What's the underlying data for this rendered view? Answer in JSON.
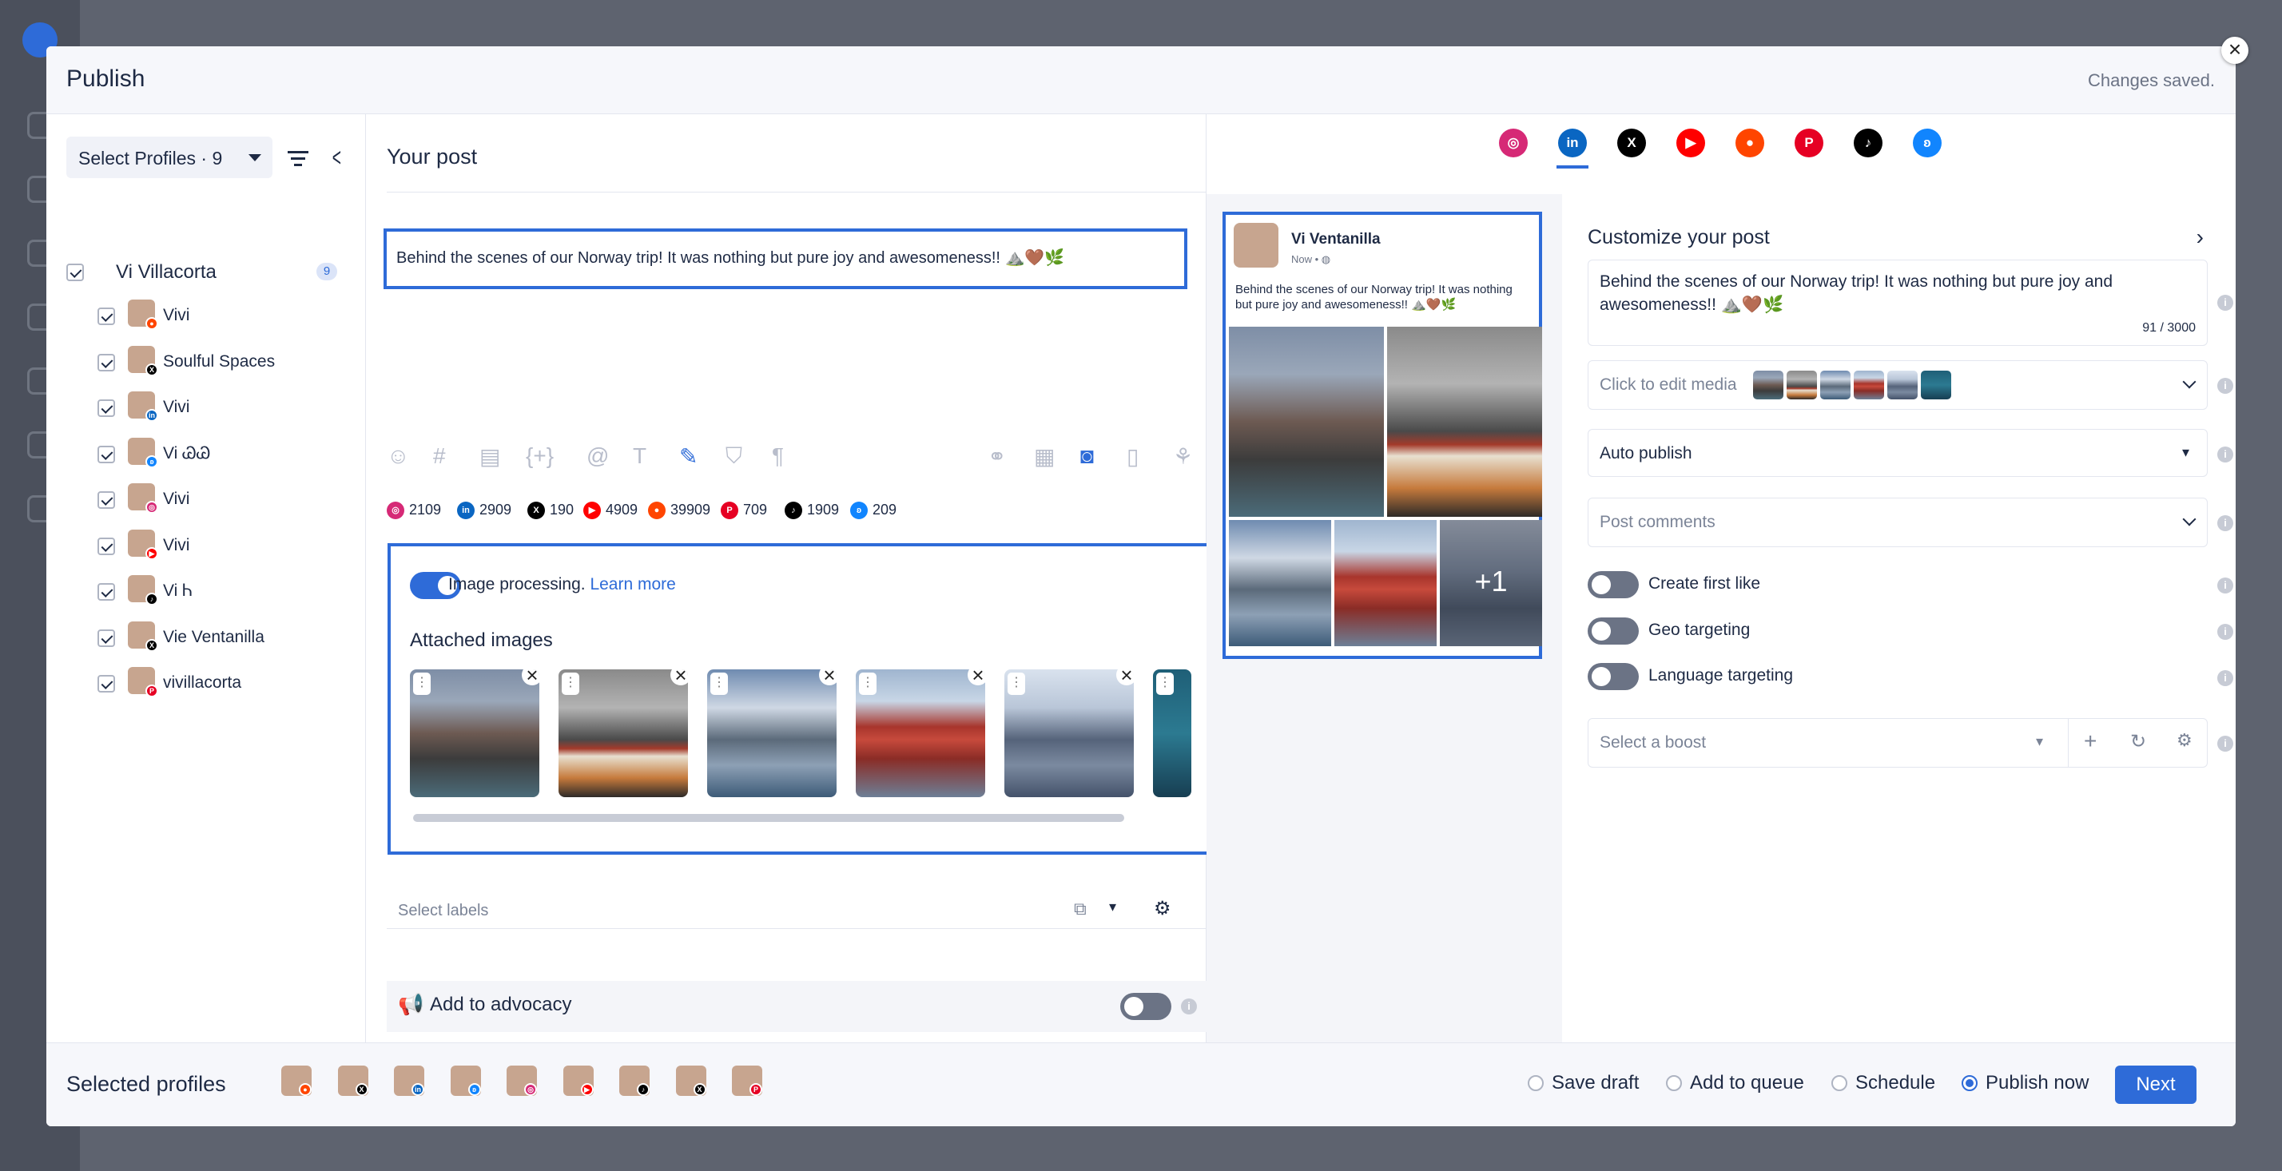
{
  "modal": {
    "title": "Publish",
    "status": "Changes saved."
  },
  "left": {
    "select_label": "Select Profiles · 9",
    "group": {
      "name": "Vi Villacorta",
      "count": "9"
    },
    "profiles": [
      {
        "name": "Vivi",
        "network": "reddit",
        "color": "#ff4500"
      },
      {
        "name": "Soulful Spaces",
        "network": "x",
        "color": "#000000"
      },
      {
        "name": "Vivi",
        "network": "linkedin",
        "color": "#0a66c2"
      },
      {
        "name": "Vi ᏊᏊ",
        "network": "bluesky",
        "color": "#1185fe"
      },
      {
        "name": "Vivi",
        "network": "instagram",
        "color": "#d62976"
      },
      {
        "name": "Vivi",
        "network": "youtube",
        "color": "#ff0000"
      },
      {
        "name": "Vi Ꮒ",
        "network": "tiktok",
        "color": "#000000"
      },
      {
        "name": "Vie Ventanilla",
        "network": "x",
        "color": "#000000"
      },
      {
        "name": "vivillacorta",
        "network": "pinterest",
        "color": "#e60023"
      }
    ]
  },
  "post": {
    "title": "Your post",
    "text": "Behind the scenes of our Norway trip! It was nothing but pure joy and awesomeness!! ⛰️🤎🌿",
    "counts": [
      {
        "net": "instagram",
        "value": "2109",
        "color": "#d62976"
      },
      {
        "net": "linkedin",
        "value": "2909",
        "color": "#0a66c2"
      },
      {
        "net": "x",
        "value": "190",
        "color": "#000000"
      },
      {
        "net": "youtube",
        "value": "4909",
        "color": "#ff0000"
      },
      {
        "net": "reddit",
        "value": "39909",
        "color": "#ff4500"
      },
      {
        "net": "pinterest",
        "value": "709",
        "color": "#e60023"
      },
      {
        "net": "tiktok",
        "value": "1909",
        "color": "#000000"
      },
      {
        "net": "bluesky",
        "value": "209",
        "color": "#1185fe"
      }
    ],
    "image_processing": "Image processing.",
    "learn_more": "Learn more",
    "attached_title": "Attached images",
    "labels_placeholder": "Select labels",
    "advocacy": "Add to advocacy"
  },
  "preview": {
    "networks": [
      "instagram",
      "linkedin",
      "x",
      "youtube",
      "reddit",
      "pinterest",
      "tiktok",
      "bluesky"
    ],
    "card_name": "Vi Ventanilla",
    "card_time": "Now •",
    "card_text": "Behind the scenes of our Norway trip! It was nothing but pure joy and awesomeness!! ⛰️🤎🌿",
    "more_count": "+1"
  },
  "customize": {
    "title": "Customize your post",
    "text": "Behind the scenes of our Norway trip! It was nothing but pure joy and awesomeness!! ⛰️🤎🌿",
    "char_count": "91 / 3000",
    "media_label": "Click to edit media",
    "auto_publish": "Auto publish",
    "post_comments": "Post comments",
    "toggles": [
      "Create first like",
      "Geo targeting",
      "Language targeting"
    ],
    "boost_placeholder": "Select a boost"
  },
  "footer": {
    "title": "Selected profiles",
    "options": [
      "Save draft",
      "Add to queue",
      "Schedule",
      "Publish now"
    ],
    "selected_option": "Publish now",
    "next": "Next"
  }
}
